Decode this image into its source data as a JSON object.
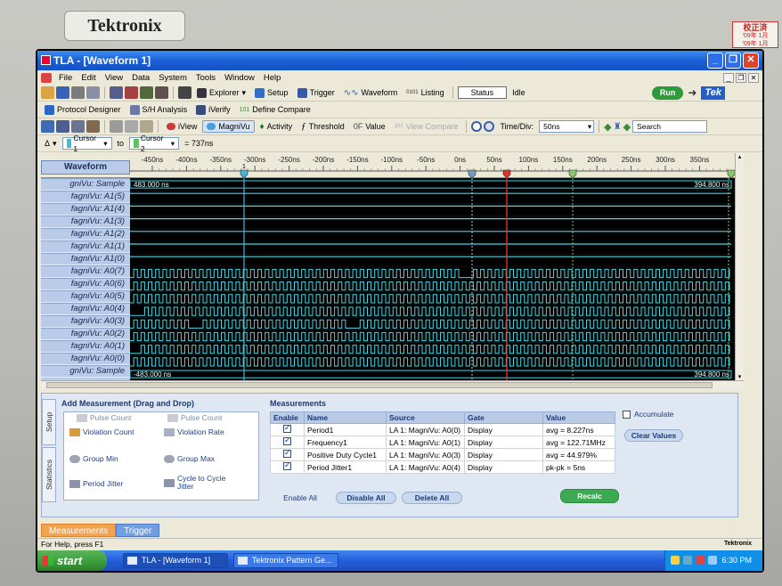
{
  "bezel": {
    "brand": "Tektronix",
    "sticker_title": "校正済",
    "sticker_lines": [
      "'09年 1月",
      "'09年 1月"
    ]
  },
  "window": {
    "title": "TLA - [Waveform 1]"
  },
  "menu": [
    "File",
    "Edit",
    "View",
    "Data",
    "System",
    "Tools",
    "Window",
    "Help"
  ],
  "toolbar1": {
    "explorer": "Explorer",
    "setup": "Setup",
    "trigger": "Trigger",
    "waveform": "Waveform",
    "listing": "Listing",
    "status_label": "Status",
    "status_value": "Idle",
    "run": "Run",
    "tek_logo": "Tek"
  },
  "toolbar2": {
    "protocol_designer": "Protocol Designer",
    "sh_analysis": "S/H Analysis",
    "iverify": "iVerify",
    "define_compare": "Define Compare"
  },
  "toolbar3": {
    "iview": "iView",
    "magnivu": "MagniVu",
    "activity": "Activity",
    "threshold": "Threshold",
    "value_prefix": "0F",
    "value": "Value",
    "view_compare": "View Compare",
    "time_div_label": "Time/Div:",
    "time_div_value": "50ns",
    "search": "Search"
  },
  "toolbar4": {
    "delta": "Δ",
    "cursor1": "Cursor 1",
    "to": "to",
    "cursor2": "Cursor 2",
    "delta_value": "= 737ns"
  },
  "waveform": {
    "header_label": "Waveform",
    "time_ticks": [
      "-450ns",
      "-400ns",
      "-350ns",
      "-300ns",
      "-250ns",
      "-200ns",
      "-150ns",
      "-100ns",
      "-50ns",
      "0ns",
      "50ns",
      "100ns",
      "150ns",
      "200ns",
      "250ns",
      "300ns",
      "350ns"
    ],
    "top_sample_start": "483.000 ns",
    "top_sample_end": "394.800 ns",
    "bottom_sample_start": "-483.000 ns",
    "bottom_sample_end": "394.800 ns",
    "cursor1_label": "1",
    "channels": [
      "gniVu: Sample",
      "fagniVu: A1(5)",
      "fagniVu: A1(4)",
      "fagniVu: A1(3)",
      "fagniVu: A1(2)",
      "fagniVu: A1(1)",
      "fagniVu: A1(0)",
      "fagniVu: A0(7)",
      "fagniVu: A0(6)",
      "fagniVu: A0(5)",
      "fagniVu: A0(4)",
      "fagniVu: A0(3)",
      "fagniVu: A0(2)",
      "fagniVu: A0(1)",
      "fagniVu: A0(0)",
      "gniVu: Sample"
    ],
    "colors": {
      "signal": "#49d6e2",
      "sample_bus": "#2fb3c4",
      "cursor": "#3fb7d8",
      "trigger": "#e03030",
      "marker": "#86c96a"
    }
  },
  "measure_panel": {
    "side_tabs": [
      "Setup",
      "Statistics"
    ],
    "add_title": "Add Measurement (Drag and Drop)",
    "add_items": [
      "Pulse Count",
      "Pulse Count",
      "Violation Count",
      "Violation Rate",
      "Group Min",
      "Group Max",
      "Period Jitter",
      "Cycle to Cycle Jitter"
    ],
    "measurements_title": "Measurements",
    "headers": [
      "Enable",
      "Name",
      "Source",
      "Gate",
      "Value"
    ],
    "rows": [
      {
        "name": "Period1",
        "source": "LA 1: MagniVu: A0(0)",
        "gate": "Display",
        "value": "avg = 8.227ns"
      },
      {
        "name": "Frequency1",
        "source": "LA 1: MagniVu: A0(1)",
        "gate": "Display",
        "value": "avg = 122.71MHz"
      },
      {
        "name": "Positive Duty Cycle1",
        "source": "LA 1: MagniVu: A0(3)",
        "gate": "Display",
        "value": "avg = 44.979%"
      },
      {
        "name": "Period Jitter1",
        "source": "LA 1: MagniVu: A0(4)",
        "gate": "Display",
        "value": "pk-pk = 5ns"
      }
    ],
    "enable_all": "Enable All",
    "disable_all": "Disable All",
    "delete_all": "Delete All",
    "recalc": "Recalc",
    "accumulate": "Accumulate",
    "clear_values": "Clear Values"
  },
  "lower_tabs": [
    "Measurements",
    "Trigger"
  ],
  "statusbar": {
    "help": "For Help, press F1",
    "brand": "Tektronix"
  },
  "taskbar": {
    "start": "start",
    "tasks": [
      "TLA - [Waveform 1]",
      "Tektronix Pattern Ge..."
    ],
    "clock": "6:30 PM"
  }
}
